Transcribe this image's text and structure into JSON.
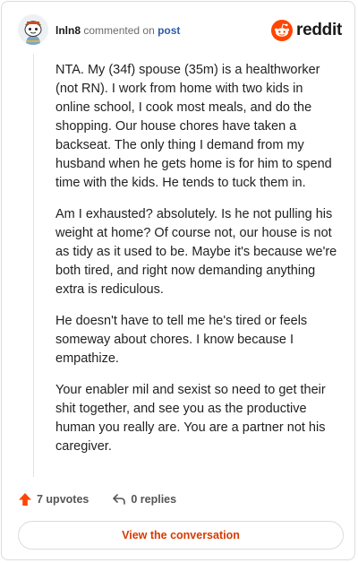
{
  "comment": {
    "author": "lnln8",
    "action_text": "commented on",
    "target_text": "post"
  },
  "brand": {
    "wordmark": "reddit",
    "accent_color": "#ff4500"
  },
  "body": {
    "paragraphs": [
      "NTA. My (34f) spouse (35m) is a healthworker (not RN). I work from home with two kids in online school, I cook most meals, and do the shopping. Our house chores have taken a backseat. The only thing I demand from my husband when he gets home is for him to spend time with the kids. He tends to tuck them in.",
      "Am I exhausted? absolutely. Is he not pulling his weight at home? Of course not, our house is not as tidy as it used to be. Maybe it's because we're both tired, and right now demanding anything extra is rediculous.",
      "He doesn't have to tell me he's tired or feels someway about chores. I know because I empathize.",
      "Your enabler mil and sexist so need to get their shit together, and see you as the productive human you really are. You are a partner not his caregiver."
    ]
  },
  "actions": {
    "upvotes": "7 upvotes",
    "replies": "0 replies",
    "upvote_color": "#ff4500"
  },
  "cta": {
    "label": "View the conversation",
    "color": "#d93a00"
  },
  "icons": {
    "avatar": "snoo-avatar-icon",
    "brand": "reddit-snoo-icon",
    "upvote": "upvote-arrow-icon",
    "reply": "reply-arrow-icon"
  }
}
